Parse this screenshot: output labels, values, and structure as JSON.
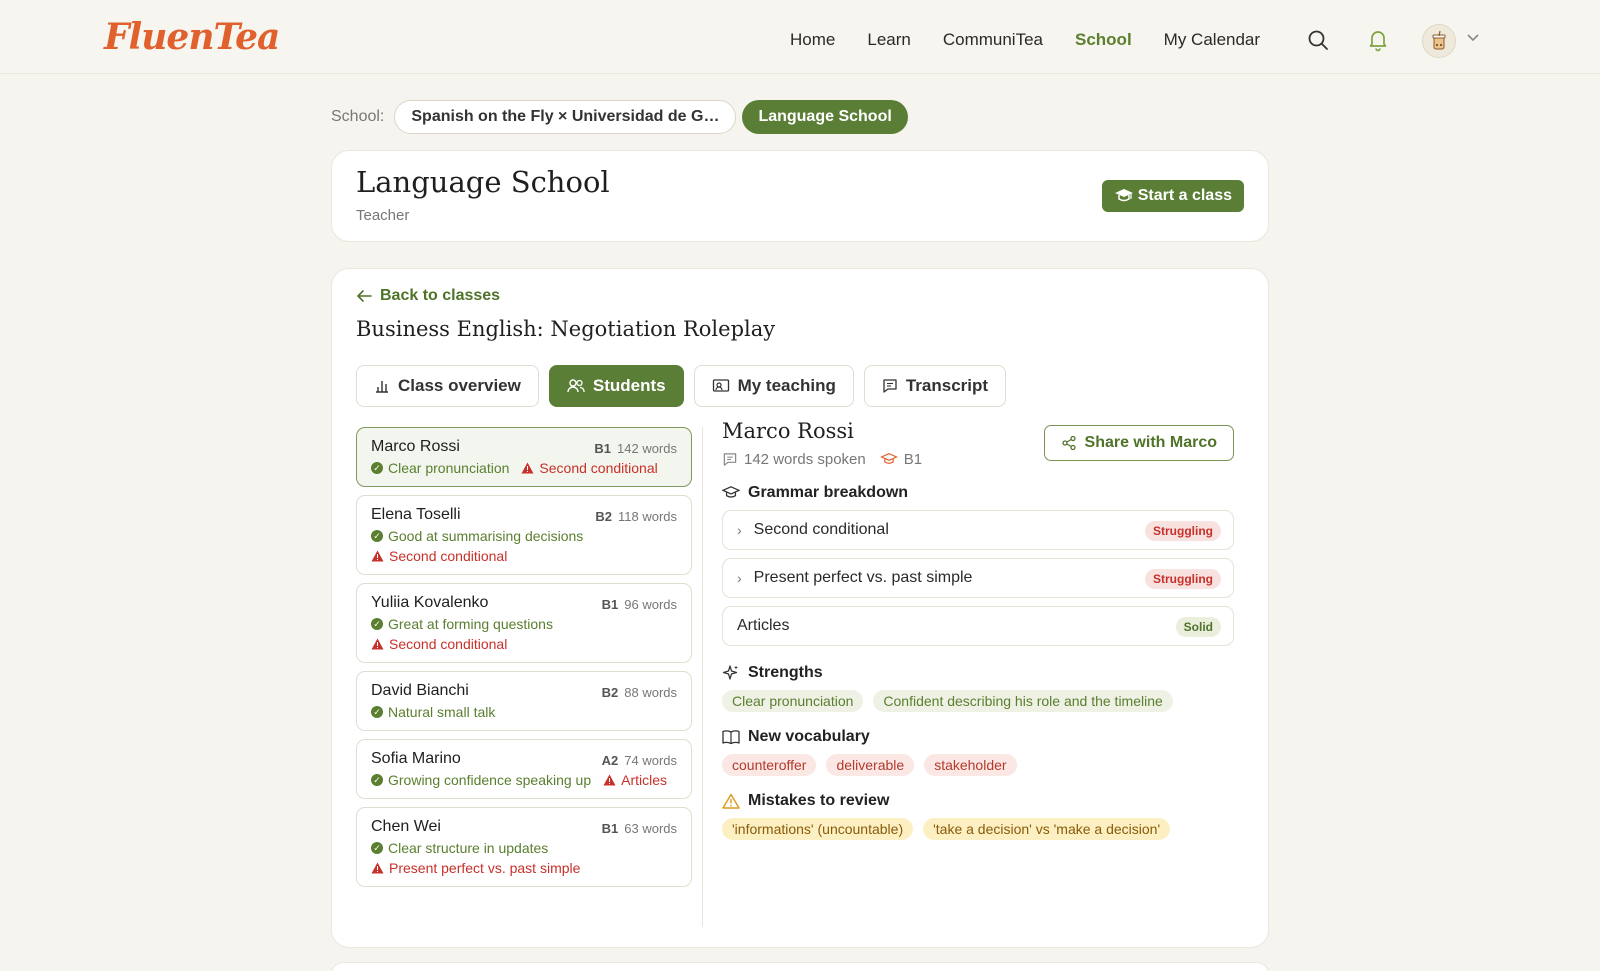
{
  "brand": {
    "logo_text": "FluenTea",
    "accent": "#5b7e36",
    "logo_color": "#e0612e",
    "danger": "#c8302a"
  },
  "nav": {
    "items": [
      "Home",
      "Learn",
      "CommuniTea",
      "School",
      "My Calendar"
    ],
    "active": "School"
  },
  "school_selector": {
    "label": "School:",
    "current_school": "Spanish on the Fly × Universidad de G…",
    "current_role": "Language School"
  },
  "header_card": {
    "title": "Language School",
    "subtitle": "Teacher",
    "start_button": "Start a class"
  },
  "class_view": {
    "back_label": "Back to classes",
    "title": "Business English: Negotiation Roleplay",
    "tabs": [
      "Class overview",
      "Students",
      "My teaching",
      "Transcript"
    ],
    "active_tab": "Students"
  },
  "students": [
    {
      "name": "Marco Rossi",
      "level": "B1",
      "words": "142 words",
      "strength": "Clear pronunciation",
      "issue": "Second conditional",
      "selected": true
    },
    {
      "name": "Elena Toselli",
      "level": "B2",
      "words": "118 words",
      "strength": "Good at summarising decisions",
      "issue": "Second conditional"
    },
    {
      "name": "Yuliia Kovalenko",
      "level": "B1",
      "words": "96 words",
      "strength": "Great at forming questions",
      "issue": "Second conditional"
    },
    {
      "name": "David Bianchi",
      "level": "B2",
      "words": "88 words",
      "strength": "Natural small talk",
      "issue": ""
    },
    {
      "name": "Sofia Marino",
      "level": "A2",
      "words": "74 words",
      "strength": "Growing confidence speaking up",
      "issue": "Articles"
    },
    {
      "name": "Chen Wei",
      "level": "B1",
      "words": "63 words",
      "strength": "Clear structure in updates",
      "issue": "Present perfect vs. past simple"
    }
  ],
  "detail": {
    "name": "Marco Rossi",
    "words_spoken": "142 words spoken",
    "level": "B1",
    "share_button": "Share with Marco",
    "grammar_heading": "Grammar breakdown",
    "grammar": [
      {
        "topic": "Second conditional",
        "status": "Struggling",
        "expandable": true
      },
      {
        "topic": "Present perfect vs. past simple",
        "status": "Struggling",
        "expandable": true
      },
      {
        "topic": "Articles",
        "status": "Solid",
        "expandable": false
      }
    ],
    "strengths_heading": "Strengths",
    "strengths": [
      "Clear pronunciation",
      "Confident describing his role and the timeline"
    ],
    "vocab_heading": "New vocabulary",
    "vocab": [
      "counteroffer",
      "deliverable",
      "stakeholder"
    ],
    "mistakes_heading": "Mistakes to review",
    "mistakes": [
      "'informations' (uncountable)",
      "'take a decision' vs 'make a decision'"
    ]
  }
}
